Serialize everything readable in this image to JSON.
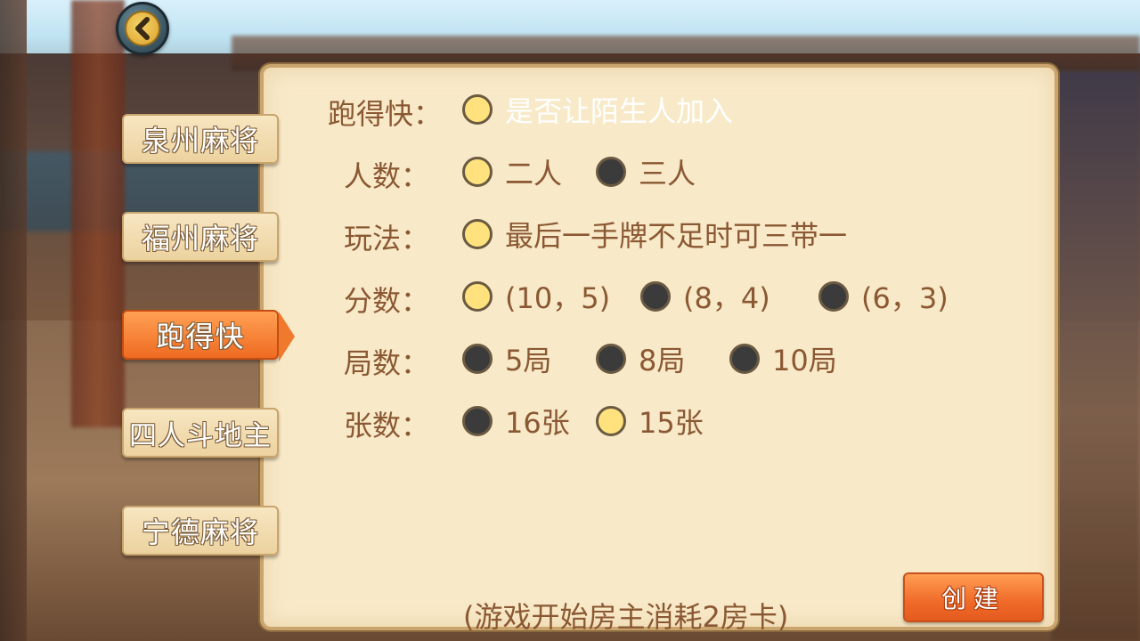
{
  "tabs": [
    {
      "label": "泉州麻将",
      "active": false
    },
    {
      "label": "福州麻将",
      "active": false
    },
    {
      "label": "跑得快",
      "active": true
    },
    {
      "label": "四人斗地主",
      "active": false
    },
    {
      "label": "宁德麻将",
      "active": false
    }
  ],
  "rows": {
    "title": {
      "label": "跑得快：",
      "options": [
        {
          "text": "是否让陌生人加入",
          "selected": true
        }
      ]
    },
    "players": {
      "label": "人数：",
      "options": [
        {
          "text": "二人",
          "selected": true
        },
        {
          "text": "三人",
          "selected": false
        }
      ]
    },
    "rule": {
      "label": "玩法：",
      "options": [
        {
          "text": "最后一手牌不足时可三带一",
          "selected": true
        }
      ]
    },
    "score": {
      "label": "分数：",
      "options": [
        {
          "text": "(10，5)",
          "selected": true
        },
        {
          "text": "(8，4)",
          "selected": false
        },
        {
          "text": "(6，3)",
          "selected": false
        }
      ]
    },
    "rounds": {
      "label": "局数：",
      "options": [
        {
          "text": "5局",
          "selected": false
        },
        {
          "text": "8局",
          "selected": false
        },
        {
          "text": "10局",
          "selected": false
        }
      ]
    },
    "cards": {
      "label": "张数：",
      "options": [
        {
          "text": "16张",
          "selected": false
        },
        {
          "text": "15张",
          "selected": true
        }
      ]
    }
  },
  "create_label": "创建",
  "footer_note": "(游戏开始房主消耗2房卡)",
  "icons": {
    "back": "chevron-left-icon"
  },
  "colors": {
    "accent": "#ef6a22",
    "selected": "#ffe27d",
    "unselected": "#3b3b3b",
    "text": "#8a5833"
  }
}
